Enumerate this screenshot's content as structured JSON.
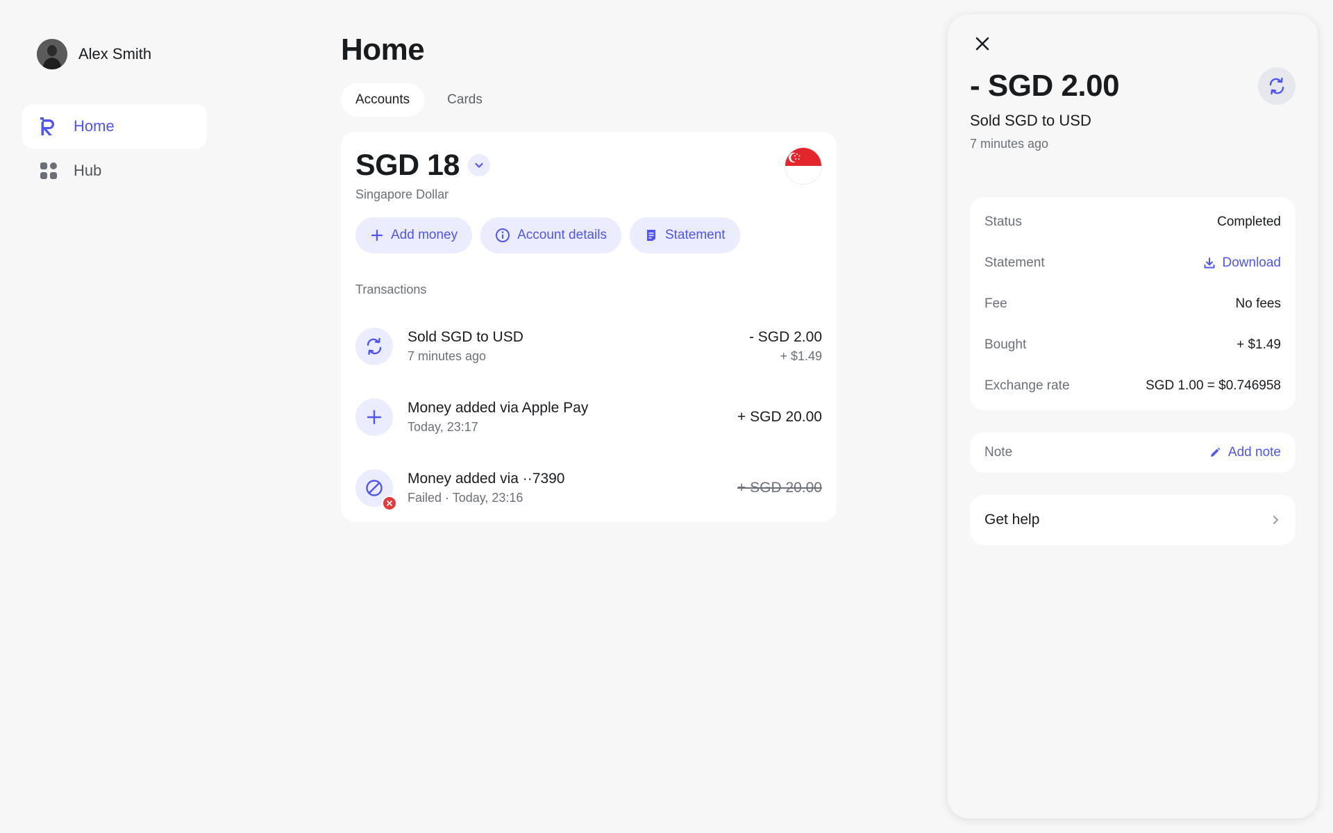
{
  "user": {
    "name": "Alex Smith"
  },
  "sidebar": {
    "items": [
      {
        "label": "Home",
        "icon": "revolut-logo-icon",
        "active": true
      },
      {
        "label": "Hub",
        "icon": "grid-icon",
        "active": false
      }
    ]
  },
  "main": {
    "title": "Home",
    "tabs": [
      {
        "label": "Accounts",
        "active": true
      },
      {
        "label": "Cards",
        "active": false
      }
    ],
    "account": {
      "balance": "SGD 18",
      "currency_name": "Singapore Dollar",
      "flag": "singapore-flag-icon",
      "actions": [
        {
          "label": "Add money",
          "icon": "plus-icon"
        },
        {
          "label": "Account details",
          "icon": "info-icon"
        },
        {
          "label": "Statement",
          "icon": "document-icon"
        }
      ]
    },
    "transactions_label": "Transactions",
    "transactions": [
      {
        "title": "Sold SGD to USD",
        "subtitle": "7 minutes ago",
        "amount": "- SGD 2.00",
        "amount_sub": "+ $1.49",
        "icon": "exchange-icon",
        "failed": false
      },
      {
        "title": "Money added via Apple Pay",
        "subtitle": "Today, 23:17",
        "amount": "+ SGD 20.00",
        "amount_sub": "",
        "icon": "plus-icon",
        "failed": false
      },
      {
        "title": "Money added via ··7390",
        "subtitle": "Failed · Today, 23:16",
        "amount": "+ SGD 20.00",
        "amount_sub": "",
        "icon": "blocked-icon",
        "failed": true
      }
    ]
  },
  "panel": {
    "amount": "- SGD 2.00",
    "title": "Sold SGD to USD",
    "time": "7 minutes ago",
    "details": [
      {
        "label": "Status",
        "value": "Completed"
      },
      {
        "label": "Statement",
        "value": "Download"
      },
      {
        "label": "Fee",
        "value": "No fees"
      },
      {
        "label": "Bought",
        "value": "+ $1.49"
      },
      {
        "label": "Exchange rate",
        "value": "SGD 1.00 = $0.746958"
      }
    ],
    "note": {
      "label": "Note",
      "action": "Add note"
    },
    "help": "Get help"
  },
  "colors": {
    "accent": "#4f55f1",
    "accent_light": "#ebecfd",
    "background": "#f7f7f7",
    "text": "#191c1f",
    "muted": "#6b7078",
    "danger": "#e23b3b"
  }
}
